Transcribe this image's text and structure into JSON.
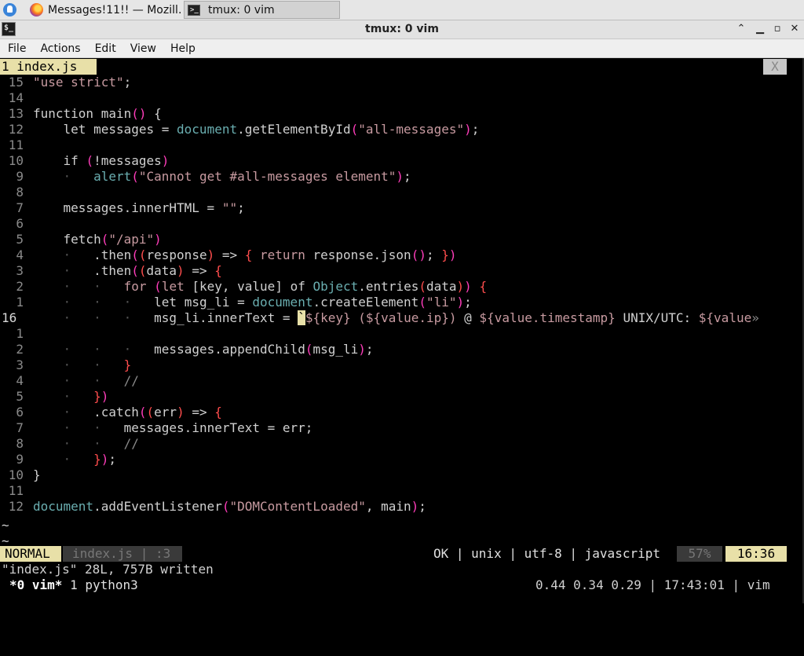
{
  "taskbar": {
    "firefox_title": "Messages!11!! — Mozill…",
    "tmux_title": "tmux: 0 vim"
  },
  "window": {
    "title": "tmux: 0 vim",
    "terminal_glyph": "$_"
  },
  "menu": [
    "File",
    "Actions",
    "Edit",
    "View",
    "Help"
  ],
  "vim": {
    "tab_label": "1 index.js",
    "close_label": "X",
    "lines": [
      {
        "n": "15",
        "html": "<span class=\"s\">\"use strict\"</span>;"
      },
      {
        "n": "14",
        "html": ""
      },
      {
        "n": "13",
        "html": "function main<span class=\"p\">()</span> {"
      },
      {
        "n": "12",
        "html": "    let messages = <span class=\"f\">document</span>.getElementById<span class=\"p\">(</span><span class=\"s\">\"all-messages\"</span><span class=\"p\">)</span>;"
      },
      {
        "n": "11",
        "html": ""
      },
      {
        "n": "10",
        "html": "    if <span class=\"p\">(</span>!messages<span class=\"p\">)</span>"
      },
      {
        "n": "9",
        "html": "    <span class=\"d\">·</span>   <span class=\"f\">alert</span><span class=\"p\">(</span><span class=\"s\">\"Cannot get #all-messages element\"</span><span class=\"p\">)</span>;"
      },
      {
        "n": "8",
        "html": ""
      },
      {
        "n": "7",
        "html": "    messages.innerHTML = <span class=\"s\">\"\"</span>;"
      },
      {
        "n": "6",
        "html": ""
      },
      {
        "n": "5",
        "html": "    fetch<span class=\"p\">(</span><span class=\"s\">\"/api\"</span><span class=\"p\">)</span>"
      },
      {
        "n": "4",
        "html": "    <span class=\"d\">·</span>   .then<span class=\"p\">(</span><span class=\"r\">(</span>response<span class=\"r\">)</span> =&gt; <span class=\"r\">{</span> <span class=\"k\">return</span> response.json<span class=\"p\">()</span>; <span class=\"r\">}</span><span class=\"p\">)</span>"
      },
      {
        "n": "3",
        "html": "    <span class=\"d\">·</span>   .then<span class=\"p\">(</span><span class=\"r\">(</span>data<span class=\"r\">)</span> =&gt; <span class=\"r\">{</span>"
      },
      {
        "n": "2",
        "html": "    <span class=\"d\">·</span>   <span class=\"d\">·</span>   <span class=\"k\">for</span> <span class=\"p\">(</span><span class=\"k\">let</span> [key, value] of <span class=\"f\">Object</span>.entries<span class=\"r\">(</span>data<span class=\"r\">)</span><span class=\"p\">)</span> <span class=\"r\">{</span>"
      },
      {
        "n": "1",
        "html": "    <span class=\"d\">·</span>   <span class=\"d\">·</span>   <span class=\"d\">·</span>   let msg_li = <span class=\"f\">document</span>.createElement<span class=\"p\">(</span><span class=\"s\">\"li\"</span><span class=\"p\">)</span>;"
      },
      {
        "n": "16",
        "cur": true,
        "html": "    <span class=\"d\">·</span>   <span class=\"d\">·</span>   <span class=\"d\">·</span>   msg_li.innerText = <span class=\"cursor\">`</span><span class=\"s\">${key}</span> <span class=\"s\">(</span><span class=\"s\">${value.ip}</span><span class=\"s\">)</span> @ <span class=\"s\">${value.timestamp}</span> UNIX/UTC: <span class=\"s\">${value</span><span class=\"cm\">»</span>"
      },
      {
        "n": "1",
        "html": ""
      },
      {
        "n": "2",
        "html": "    <span class=\"d\">·</span>   <span class=\"d\">·</span>   <span class=\"d\">·</span>   messages.appendChild<span class=\"p\">(</span>msg_li<span class=\"p\">)</span>;"
      },
      {
        "n": "3",
        "html": "    <span class=\"d\">·</span>   <span class=\"d\">·</span>   <span class=\"r\">}</span>"
      },
      {
        "n": "4",
        "html": "    <span class=\"d\">·</span>   <span class=\"d\">·</span>   <span class=\"c\">//</span>"
      },
      {
        "n": "5",
        "html": "    <span class=\"d\">·</span>   <span class=\"r\">}</span><span class=\"p\">)</span>"
      },
      {
        "n": "6",
        "html": "    <span class=\"d\">·</span>   .catch<span class=\"p\">(</span><span class=\"r\">(</span>err<span class=\"r\">)</span> =&gt; <span class=\"r\">{</span>"
      },
      {
        "n": "7",
        "html": "    <span class=\"d\">·</span>   <span class=\"d\">·</span>   messages.innerText = err;"
      },
      {
        "n": "8",
        "html": "    <span class=\"d\">·</span>   <span class=\"d\">·</span>   <span class=\"c\">//</span>"
      },
      {
        "n": "9",
        "html": "    <span class=\"d\">·</span>   <span class=\"r\">}</span><span class=\"p\">)</span>;"
      },
      {
        "n": "10",
        "html": "}"
      },
      {
        "n": "11",
        "html": ""
      },
      {
        "n": "12",
        "html": "<span class=\"f\">document</span>.addEventListener<span class=\"p\">(</span><span class=\"s\">\"DOMContentLoaded\"</span>, main<span class=\"p\">)</span>;"
      }
    ],
    "tilde": "~",
    "status": {
      "mode": "NORMAL",
      "file": "index.js | :3",
      "right": "OK | unix | utf-8 | javascript",
      "percent": "57%",
      "position": "16:36"
    },
    "message": "\"index.js\" 28L, 757B written"
  },
  "tmux": {
    "window": "*0 vim*",
    "other": "1 python3",
    "right": "0.44 0.34 0.29 | 17:43:01 | vim"
  }
}
